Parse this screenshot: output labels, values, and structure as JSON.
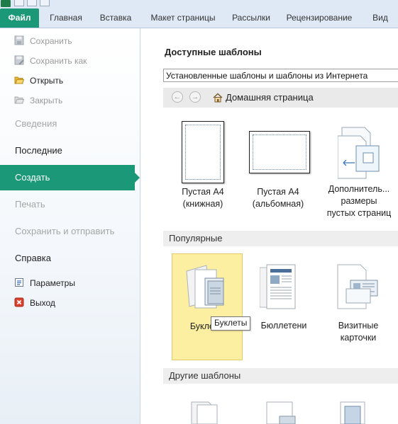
{
  "ribbon": {
    "tabs": [
      "Файл",
      "Главная",
      "Вставка",
      "Макет страницы",
      "Рассылки",
      "Рецензирование",
      "Вид"
    ]
  },
  "nav": {
    "commands_top": [
      {
        "label": "Сохранить",
        "icon": "save-icon",
        "enabled": false
      },
      {
        "label": "Сохранить как",
        "icon": "save-as-icon",
        "enabled": false
      },
      {
        "label": "Открыть",
        "icon": "open-folder-icon",
        "enabled": true
      },
      {
        "label": "Закрыть",
        "icon": "close-folder-icon",
        "enabled": false
      }
    ],
    "sections": [
      {
        "label": "Сведения",
        "enabled": false
      },
      {
        "label": "Последние",
        "enabled": true
      },
      {
        "label": "Создать",
        "enabled": true,
        "selected": true
      },
      {
        "label": "Печать",
        "enabled": false
      },
      {
        "label": "Сохранить и отправить",
        "enabled": false
      },
      {
        "label": "Справка",
        "enabled": true
      }
    ],
    "commands_bottom": [
      {
        "label": "Параметры",
        "icon": "options-icon",
        "enabled": true
      },
      {
        "label": "Выход",
        "icon": "exit-icon",
        "enabled": true
      }
    ]
  },
  "main": {
    "heading": "Доступные шаблоны",
    "source_select": "Установленные шаблоны и шаблоны из Интернета",
    "home_label": "Домашняя страница",
    "blank_templates": [
      {
        "label": "Пустая А4\n(книжная)"
      },
      {
        "label": "Пустая А4\n(альбомная)"
      },
      {
        "label": "Дополнитель...\nразмеры\nпустых страниц"
      }
    ],
    "popular_header": "Популярные",
    "popular": [
      {
        "label": "Буклеты",
        "selected": true
      },
      {
        "label": "Бюллетени"
      },
      {
        "label": "Визитные\nкарточки"
      }
    ],
    "tooltip": "Буклеты",
    "other_header": "Другие шаблоны"
  },
  "colors": {
    "accent": "#1b9877",
    "selected_tile": "#fcefa1"
  }
}
